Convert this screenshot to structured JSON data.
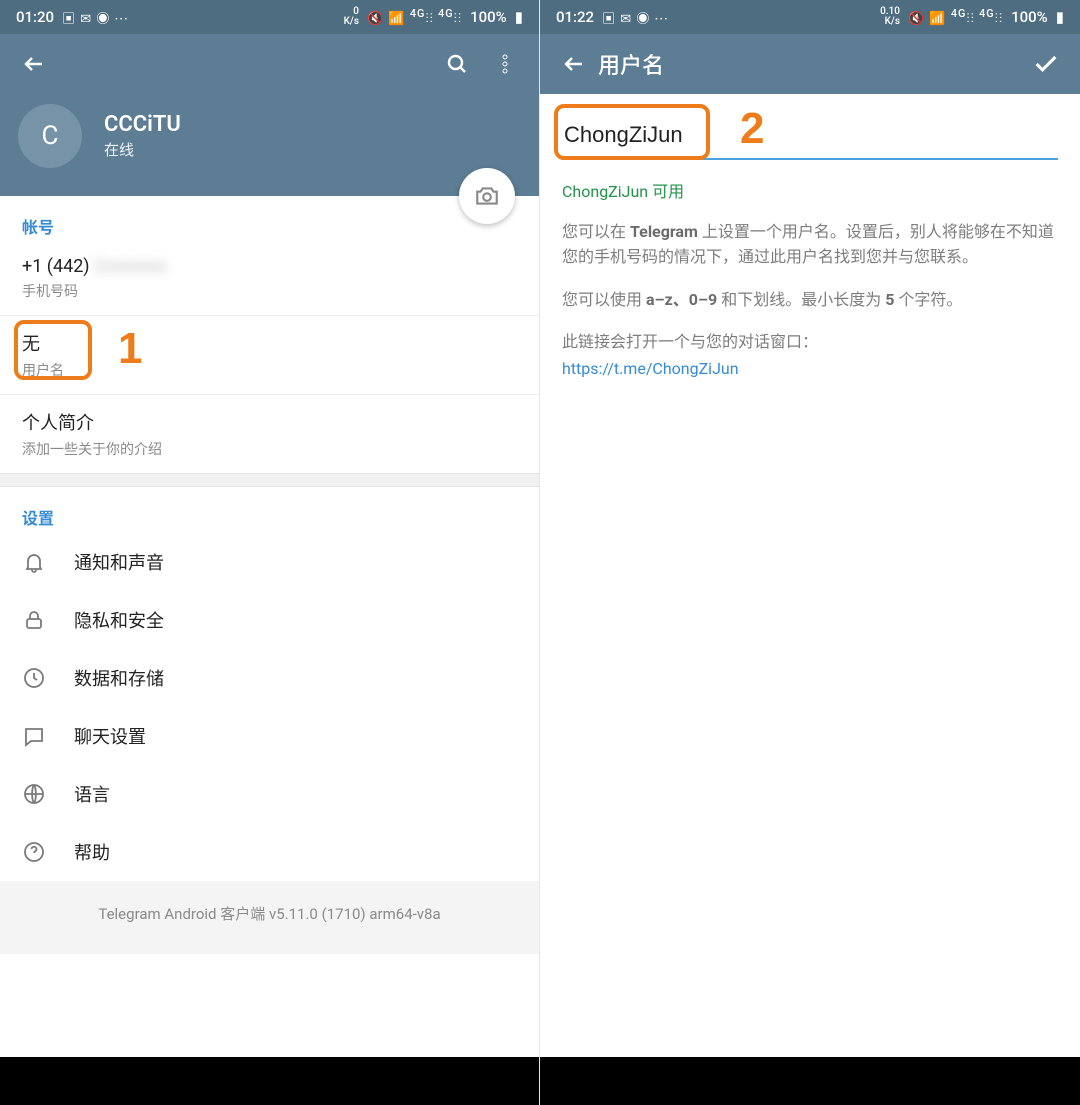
{
  "left": {
    "statusbar": {
      "time": "01:20",
      "net_rate_top": "0",
      "net_rate_unit": "K/s",
      "battery": "100%"
    },
    "profile": {
      "avatar_letter": "C",
      "name": "CCCiTU",
      "status": "在线"
    },
    "account": {
      "title": "帐号",
      "phone_prefix": "+1 (442)",
      "phone_rest": "2xxxxxxx",
      "phone_label": "手机号码",
      "username_value": "无",
      "username_label": "用户名",
      "bio_title": "个人简介",
      "bio_hint": "添加一些关于你的介绍"
    },
    "settings": {
      "title": "设置",
      "items": [
        {
          "icon": "bell",
          "label": "通知和声音"
        },
        {
          "icon": "lock",
          "label": "隐私和安全"
        },
        {
          "icon": "clock",
          "label": "数据和存储"
        },
        {
          "icon": "chat",
          "label": "聊天设置"
        },
        {
          "icon": "globe",
          "label": "语言"
        },
        {
          "icon": "help",
          "label": "帮助"
        }
      ]
    },
    "footer": "Telegram Android 客户端 v5.11.0 (1710) arm64-v8a",
    "annotation_number": "1"
  },
  "right": {
    "statusbar": {
      "time": "01:22",
      "net_rate_top": "0.10",
      "net_rate_unit": "K/s",
      "battery": "100%"
    },
    "appbar_title": "用户名",
    "username_value": "ChongZiJun",
    "available_text": "ChongZiJun 可用",
    "desc_line1_a": "您可以在 ",
    "desc_line1_b": "Telegram",
    "desc_line1_c": " 上设置一个用户名。设置后，别人将能够在不知道您的手机号码的情况下，通过此用户名找到您并与您联系。",
    "desc_line2_a": "您可以使用 ",
    "desc_line2_b": "a–z、0–9",
    "desc_line2_c": " 和下划线。最小长度为 ",
    "desc_line2_d": "5",
    "desc_line2_e": " 个字符。",
    "desc_line3": "此链接会打开一个与您的对话窗口：",
    "link": "https://t.me/ChongZiJun",
    "annotation_number": "2"
  }
}
